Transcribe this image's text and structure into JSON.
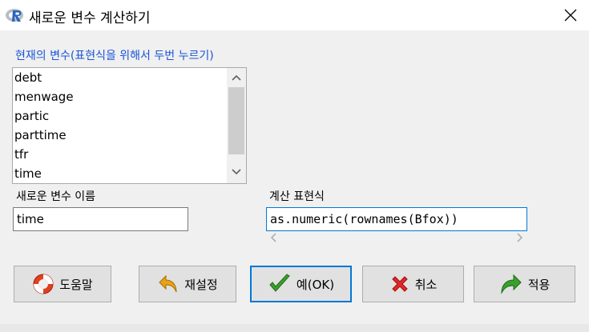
{
  "window": {
    "title": "새로운 변수 계산하기",
    "icon": "r-logo-icon",
    "close_label": "close"
  },
  "variables": {
    "label": "현재의 변수(표현식을 위해서 두번 누르기)",
    "items": [
      "debt",
      "menwage",
      "partic",
      "parttime",
      "tfr",
      "time"
    ]
  },
  "new_variable": {
    "label": "새로운 변수 이름",
    "value": "time"
  },
  "expression": {
    "label": "계산 표현식",
    "value": "as.numeric(rownames(Bfox))"
  },
  "buttons": {
    "help": "도움말",
    "reset": "재설정",
    "ok": "예(OK)",
    "cancel": "취소",
    "apply": "적용"
  },
  "colors": {
    "label_blue": "#1a55d6",
    "focus_border": "#0078d7"
  }
}
